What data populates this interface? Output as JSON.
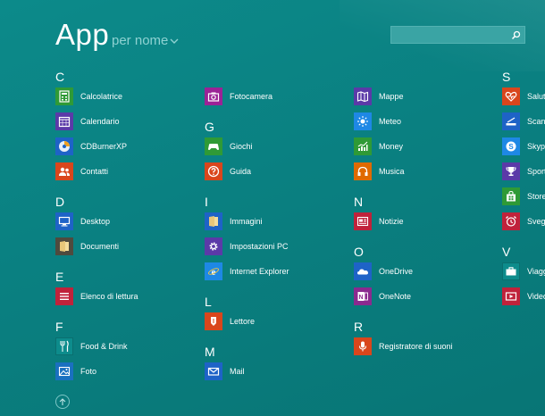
{
  "header": {
    "title": "App",
    "sort_label": "per nome",
    "search_placeholder": ""
  },
  "letters": {
    "C": "C",
    "D": "D",
    "E": "E",
    "F": "F",
    "G": "G",
    "I": "I",
    "L": "L",
    "M": "M",
    "N": "N",
    "O": "O",
    "R": "R",
    "S": "S",
    "V": "V"
  },
  "apps": {
    "calcolatrice": "Calcolatrice",
    "calendario": "Calendario",
    "cdburnerxp": "CDBurnerXP",
    "contatti": "Contatti",
    "desktop": "Desktop",
    "documenti": "Documenti",
    "elenco": "Elenco di lettura",
    "fooddrink": "Food & Drink",
    "foto": "Foto",
    "fotocamera": "Fotocamera",
    "giochi": "Giochi",
    "guida": "Guida",
    "immagini": "Immagini",
    "impostazioni": "Impostazioni PC",
    "ie": "Internet Explorer",
    "lettore": "Lettore",
    "mail": "Mail",
    "mappe": "Mappe",
    "meteo": "Meteo",
    "money": "Money",
    "musica": "Musica",
    "notizie": "Notizie",
    "onedrive": "OneDrive",
    "onenote": "OneNote",
    "registratore": "Registratore di suoni",
    "salute": "Salute",
    "scanner": "Scann",
    "skype": "Skype",
    "sport": "Sport",
    "store": "Store",
    "sveglie": "Svegli",
    "viaggi": "Viagg",
    "video": "Video"
  },
  "colors": {
    "background": "#0a7f80",
    "green": "#2f9a36",
    "purple": "#5b3aa8",
    "red_orange": "#d9461c",
    "blue": "#1e63c7",
    "crimson": "#c0223b",
    "magenta": "#9b2296",
    "orange": "#e06a00"
  }
}
